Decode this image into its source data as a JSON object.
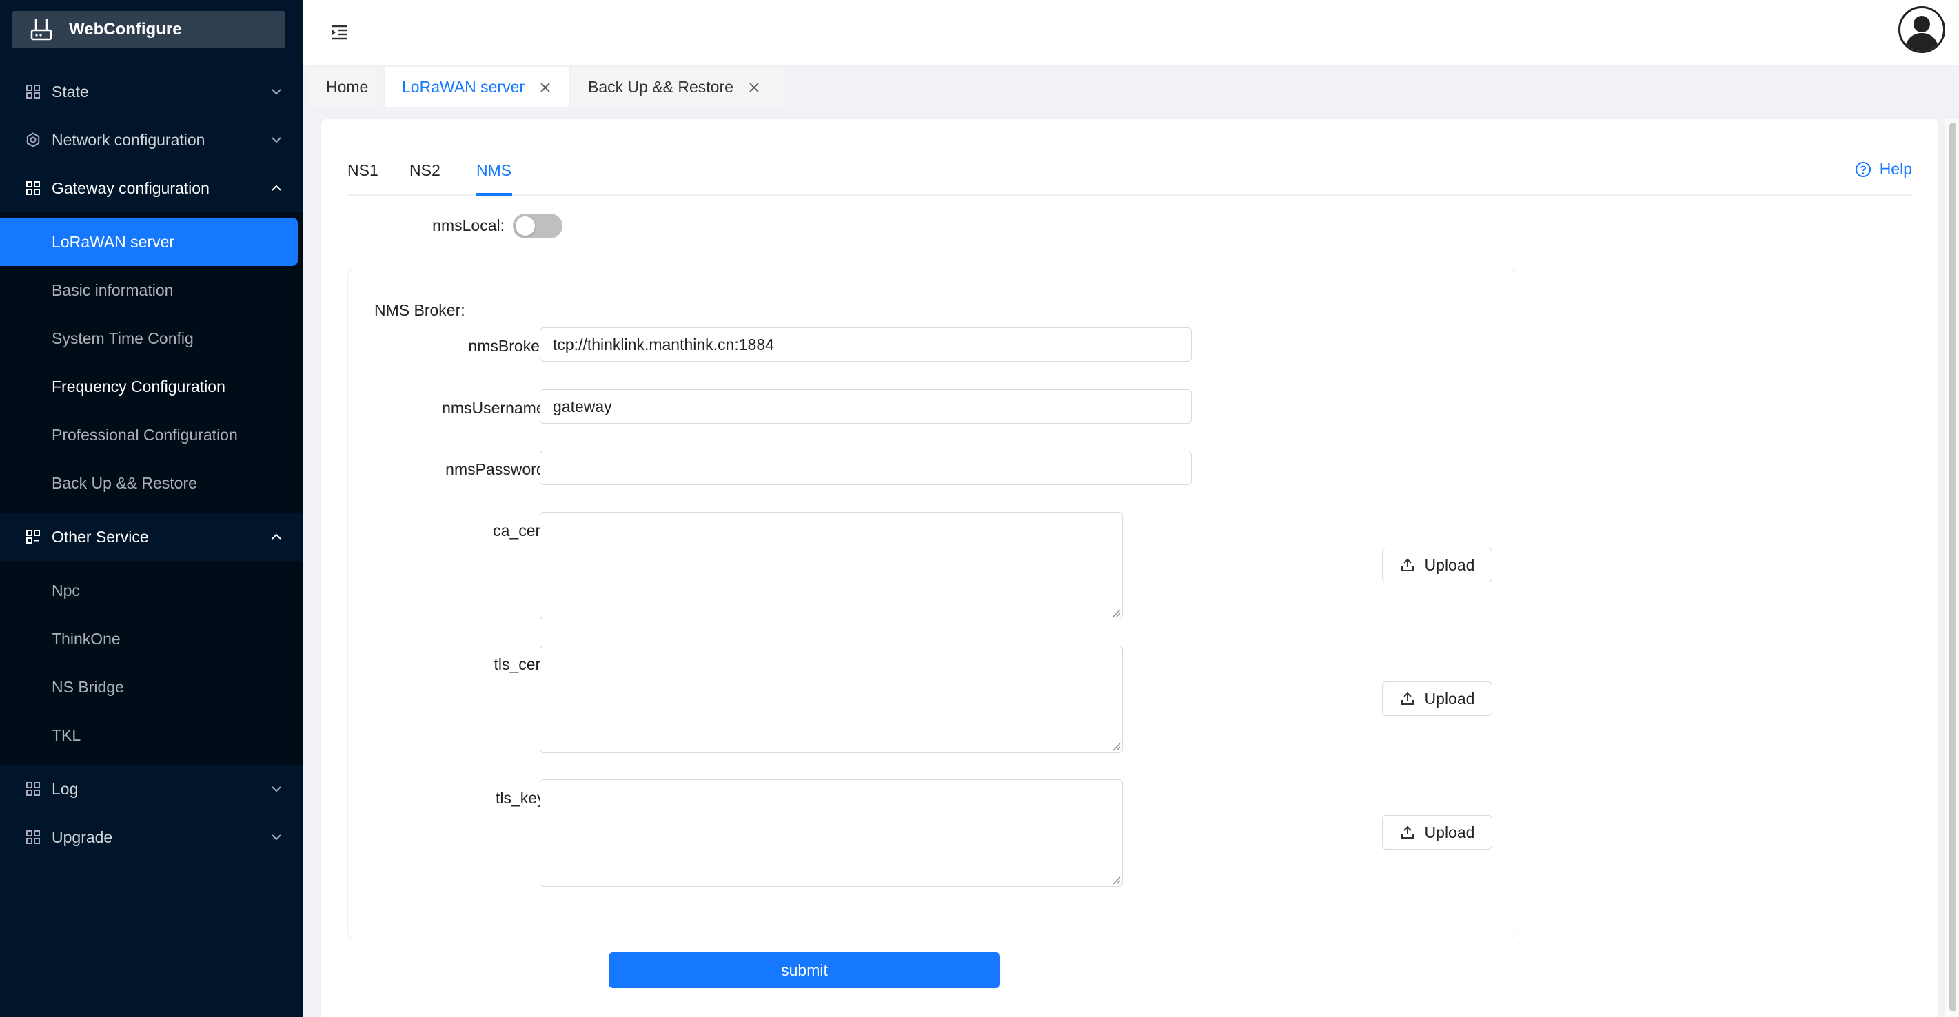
{
  "app": {
    "title": "WebConfigure"
  },
  "sidebar": {
    "items": [
      {
        "label": "State",
        "expanded": false
      },
      {
        "label": "Network configuration",
        "expanded": false
      },
      {
        "label": "Gateway configuration",
        "expanded": true,
        "children": [
          "LoRaWAN server",
          "Basic information",
          "System Time Config",
          "Frequency Configuration",
          "Professional Configuration",
          "Back Up && Restore"
        ]
      },
      {
        "label": "Other Service",
        "expanded": true,
        "children": [
          "Npc",
          "ThinkOne",
          "NS Bridge",
          "TKL"
        ]
      },
      {
        "label": "Log",
        "expanded": false
      },
      {
        "label": "Upgrade",
        "expanded": false
      }
    ],
    "active_item": "LoRaWAN server"
  },
  "tabs": [
    {
      "label": "Home",
      "closable": false,
      "active": false
    },
    {
      "label": "LoRaWAN server",
      "closable": true,
      "active": true
    },
    {
      "label": "Back Up && Restore",
      "closable": true,
      "active": false
    }
  ],
  "inner_tabs": [
    "NS1",
    "NS2",
    "NMS"
  ],
  "inner_active": "NMS",
  "help_label": "Help",
  "form": {
    "nms_local_label": "nmsLocal",
    "nms_local_on": false,
    "broker_title": "NMS Broker:",
    "broker_label": "nmsBroker",
    "broker_value": "tcp://thinklink.manthink.cn:1884",
    "username_label": "nmsUsername",
    "username_value": "gateway",
    "password_label": "nmsPassword",
    "password_value": "",
    "ca_cert_label": "ca_cert",
    "tls_cert_label": "tls_cert",
    "tls_key_label": "tls_key",
    "upload_label": "Upload",
    "submit_label": "submit"
  },
  "colors": {
    "sidebar_bg": "#001529",
    "accent": "#1677ff"
  }
}
